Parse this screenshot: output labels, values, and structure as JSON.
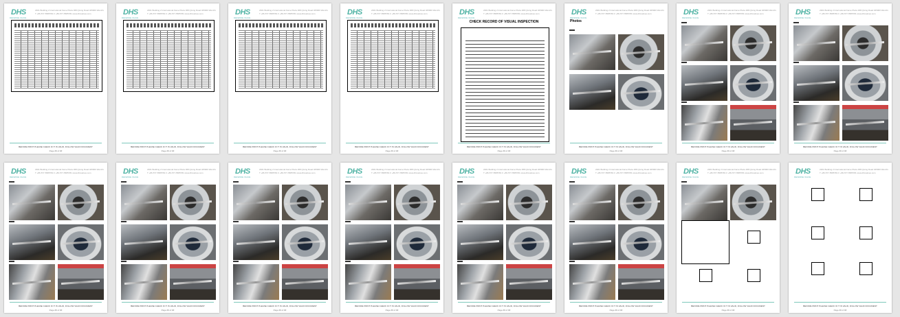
{
  "header": {
    "logo": "DHS",
    "logo_sub": "DEFENSE VALVE",
    "address_line": "2301 Building 2 International Fame Plaza 368 Qixing Road 325000 Wenzhou China",
    "contact_line": "T +86-577-5585781  F +86-577-5585781  www.dhsvalves.com"
  },
  "footer": {
    "text": "BEFORE PRINT PLEASE CHECK IF IT IS VALID, FOLLOW VALID DOCUMENT",
    "page_label": "Page ## of ##"
  },
  "pages_row1": [
    {
      "kind": "table-doc"
    },
    {
      "kind": "table-doc"
    },
    {
      "kind": "table-doc"
    },
    {
      "kind": "table-doc"
    },
    {
      "kind": "check-record",
      "title": "CHECK RECORD OF VISUAL INSPECTION"
    },
    {
      "kind": "photos",
      "heading": "Photos"
    },
    {
      "kind": "photos"
    },
    {
      "kind": "photos"
    }
  ],
  "pages_row2": [
    {
      "kind": "photos"
    },
    {
      "kind": "photos"
    },
    {
      "kind": "photos"
    },
    {
      "kind": "photos"
    },
    {
      "kind": "photos"
    },
    {
      "kind": "photos"
    },
    {
      "kind": "photos-placeholder"
    },
    {
      "kind": "placeholders"
    }
  ]
}
